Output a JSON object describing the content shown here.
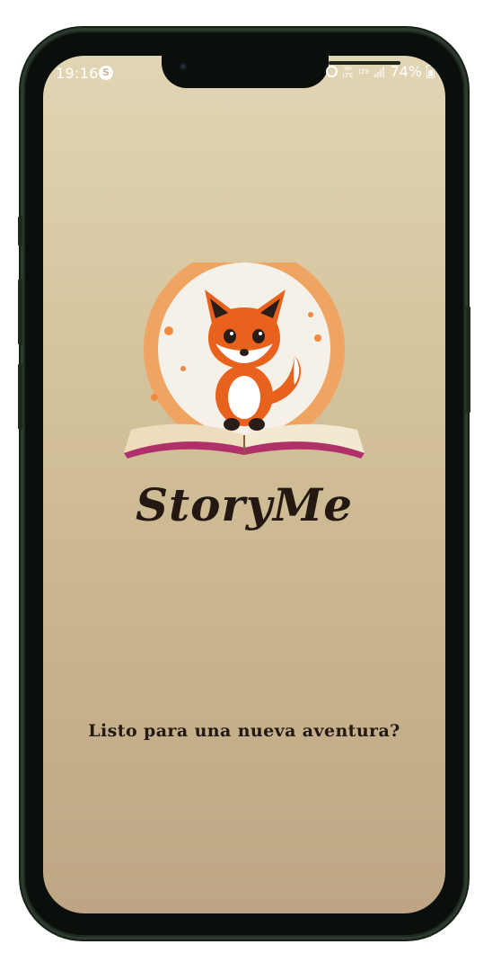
{
  "status_bar": {
    "time": "19:16",
    "app_icon_glyph": "S",
    "volte_label": "Vo LTE",
    "lte_label": "LTE",
    "battery_percent": "74%",
    "battery_level": 0.74,
    "icons": [
      "alarm-icon",
      "signal-icon",
      "battery-icon"
    ]
  },
  "splash": {
    "logo_alt": "fox-reading-book-logo",
    "app_name": "StoryMe",
    "tagline": "Listo para una nueva aventura?"
  },
  "colors": {
    "background_top": "#e1d5b4",
    "background_bottom": "#bea684",
    "fox_orange": "#e8621e",
    "title_color": "#231812",
    "book_edge": "#b0306a"
  }
}
